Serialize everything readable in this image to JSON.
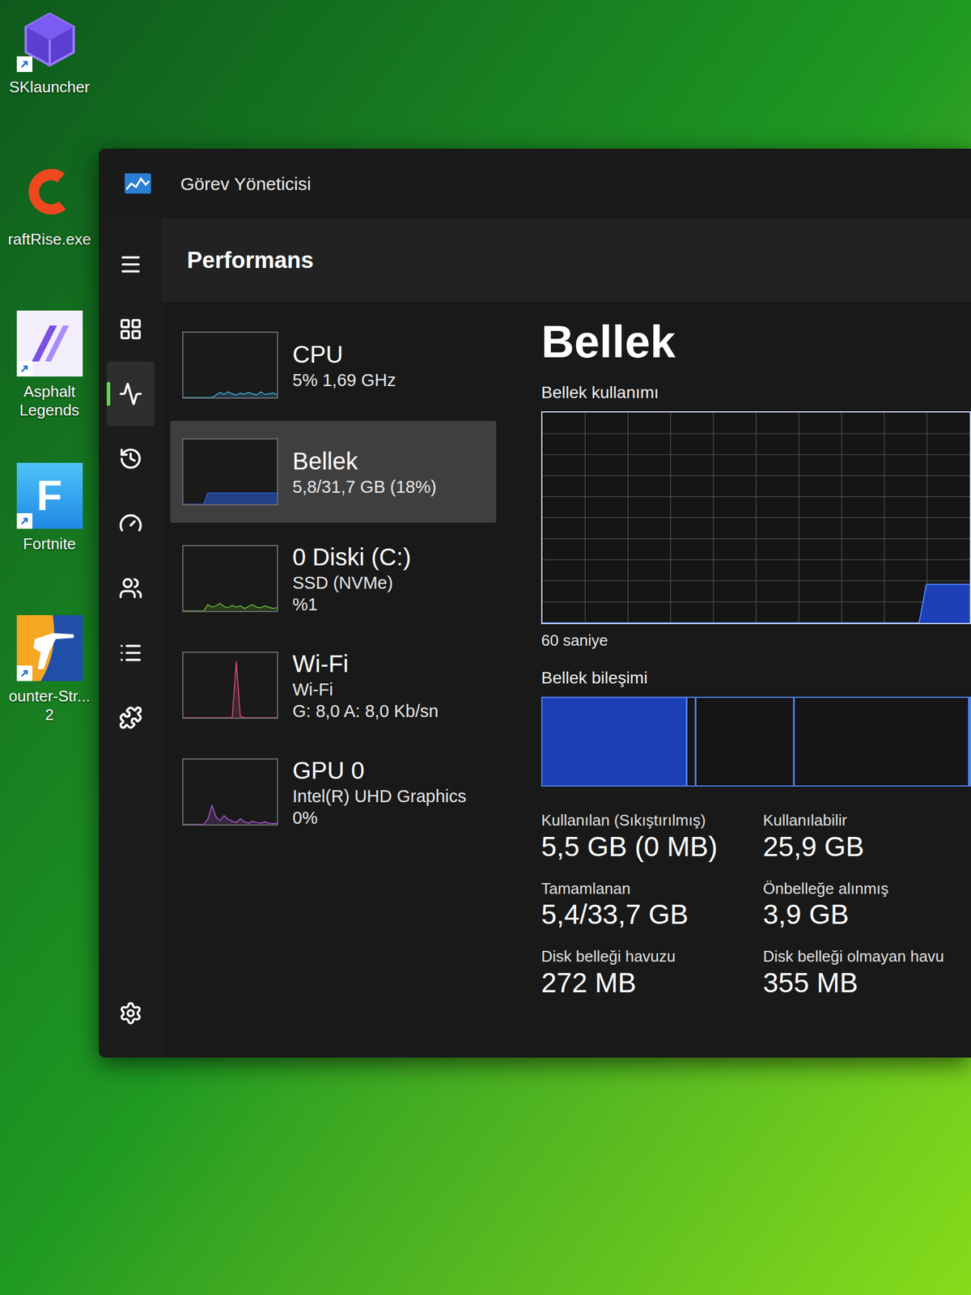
{
  "desktop_icons": [
    {
      "label": "SKlauncher",
      "kind": "sklauncher",
      "shortcut": true
    },
    {
      "label": "raftRise.exe",
      "kind": "craftrise",
      "shortcut": false
    },
    {
      "label": "Asphalt Legends",
      "kind": "asphalt",
      "shortcut": true
    },
    {
      "label": "Fortnite",
      "kind": "fortnite",
      "shortcut": true,
      "glyph": "F"
    },
    {
      "label": "ounter-Str... 2",
      "kind": "cs2",
      "shortcut": true
    }
  ],
  "window": {
    "title": "Görev Yöneticisi"
  },
  "nav": [
    {
      "selected": false
    },
    {
      "selected": false
    },
    {
      "selected": true
    },
    {
      "selected": false
    },
    {
      "selected": false
    },
    {
      "selected": false
    },
    {
      "selected": false
    },
    {
      "selected": false
    },
    {
      "selected": false
    }
  ],
  "header": "Performans",
  "devices": [
    {
      "name": "CPU",
      "lines": [
        "5% 1,69 GHz"
      ],
      "selected": false,
      "color": "#3fb6e8",
      "values": [
        0,
        0,
        0,
        0,
        0,
        0,
        0,
        0,
        4,
        8,
        5,
        9,
        6,
        4,
        7,
        5,
        8,
        6,
        4,
        9,
        5,
        6,
        7,
        5
      ]
    },
    {
      "name": "Bellek",
      "lines": [
        "5,8/31,7 GB (18%)"
      ],
      "selected": true,
      "color": "#2a63e0",
      "values": [
        0,
        0,
        0,
        0,
        0,
        0,
        18,
        18,
        18,
        18,
        18,
        18,
        18,
        18,
        18,
        18,
        18,
        18,
        18,
        18,
        18,
        18,
        18,
        18
      ]
    },
    {
      "name": "0 Diski (C:)",
      "lines": [
        "SSD (NVMe)",
        "%1"
      ],
      "selected": false,
      "color": "#6fc43a",
      "values": [
        0,
        0,
        0,
        0,
        0,
        0,
        10,
        6,
        8,
        12,
        7,
        5,
        9,
        6,
        8,
        4,
        7,
        10,
        6,
        5,
        8,
        6,
        4,
        5
      ]
    },
    {
      "name": "Wi-Fi",
      "lines": [
        "Wi-Fi",
        "G: 8,0 A: 8,0 Kb/sn"
      ],
      "selected": false,
      "color": "#e0508a",
      "values": [
        0,
        0,
        0,
        0,
        0,
        0,
        0,
        0,
        0,
        0,
        0,
        0,
        0,
        90,
        2,
        0,
        0,
        0,
        0,
        0,
        0,
        0,
        0,
        0
      ]
    },
    {
      "name": "GPU 0",
      "lines": [
        "Intel(R) UHD Graphics",
        "0%"
      ],
      "selected": false,
      "color": "#b05ad8",
      "values": [
        0,
        0,
        0,
        0,
        0,
        0,
        8,
        30,
        12,
        6,
        14,
        8,
        5,
        3,
        9,
        4,
        2,
        5,
        3,
        2,
        4,
        2,
        1,
        2
      ]
    }
  ],
  "detail": {
    "title": "Bellek",
    "chart": {
      "title": "Bellek kullanımı",
      "time_label": "60 saniye",
      "values": [
        0,
        0,
        0,
        0,
        0,
        0,
        0,
        0,
        0,
        0,
        0,
        0,
        0,
        0,
        0,
        0,
        0,
        0,
        0,
        0,
        0,
        0,
        0,
        0,
        0,
        0,
        0,
        0,
        0,
        0,
        0,
        0,
        0,
        0,
        0,
        0,
        0,
        0,
        0,
        0,
        0,
        0,
        0,
        0,
        0,
        0,
        0,
        0,
        0,
        0,
        0,
        0,
        0,
        5.8,
        5.8,
        5.8,
        5.8,
        5.8,
        5.8,
        5.8
      ]
    },
    "composition": {
      "title": "Bellek bileşimi",
      "segments": [
        {
          "level": 0.34,
          "filled": true
        },
        {
          "level": 0.02,
          "filled": false
        },
        {
          "level": 0.23,
          "filled": false
        },
        {
          "level": 0.41,
          "filled": false
        }
      ]
    },
    "stats": [
      {
        "label": "Kullanılan (Sıkıştırılmış)",
        "value": "5,5 GB (0 MB)"
      },
      {
        "label": "Kullanılabilir",
        "value": "25,9 GB"
      },
      {
        "label": "Tamamlanan",
        "value": "5,4/33,7 GB"
      },
      {
        "label": "Önbelleğe alınmış",
        "value": "3,9 GB"
      },
      {
        "label": "Disk belleği havuzu",
        "value": "272 MB"
      },
      {
        "label": "Disk belleği olmayan havu",
        "value": "355 MB"
      }
    ]
  }
}
